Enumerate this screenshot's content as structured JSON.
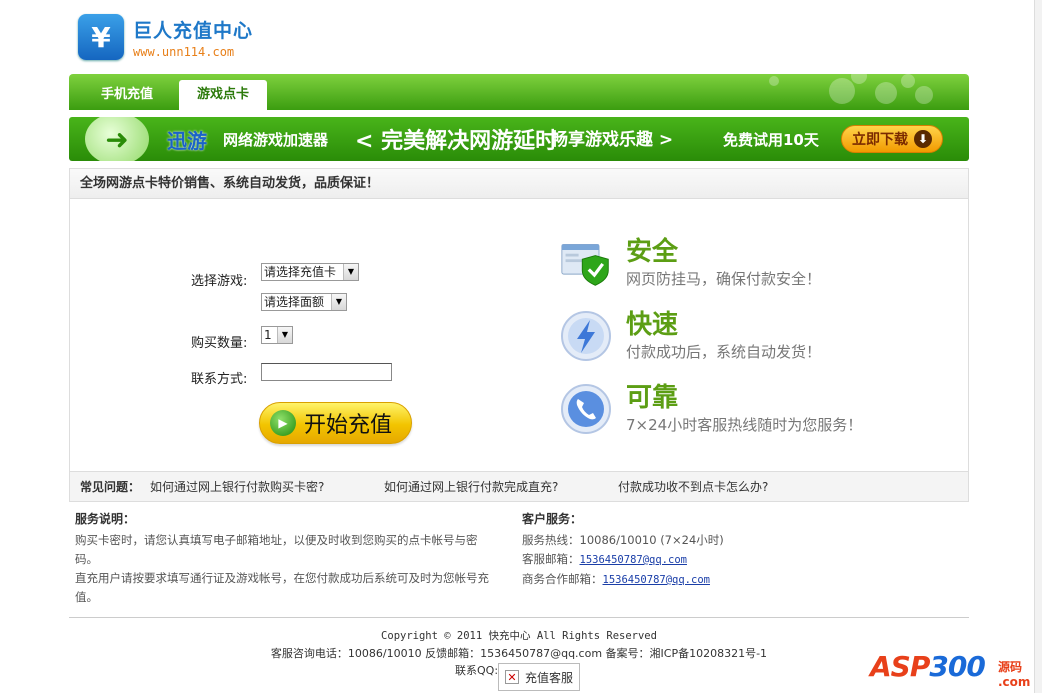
{
  "logo": {
    "title": "巨人充值中心",
    "url": "www.unn114.com",
    "icon": "yen-icon"
  },
  "nav": {
    "tabs": [
      {
        "label": "手机充值"
      },
      {
        "label": "游戏点卡"
      }
    ]
  },
  "banner": {
    "brand": "迅游",
    "product": "网络游戏加速器",
    "slogan1": "< 完美解决网游延时",
    "slogan2": "畅享游戏乐趣 >",
    "trial": "免费试用10天",
    "download_button": "立即下载"
  },
  "notice": "全场网游点卡特价销售、系统自动发货，品质保证！",
  "form": {
    "game_label": "选择游戏:",
    "card_select": "请选择充值卡",
    "amount_select": "请选择面额",
    "quantity_label": "购买数量:",
    "quantity_value": "1",
    "contact_label": "联系方式:",
    "contact_value": "",
    "start_button": "开始充值"
  },
  "features": [
    {
      "title": "安全",
      "desc": "网页防挂马，确保付款安全！",
      "icon": "shield-check-icon"
    },
    {
      "title": "快速",
      "desc": "付款成功后，系统自动发货！",
      "icon": "lightning-icon"
    },
    {
      "title": "可靠",
      "desc": "7×24小时客服热线随时为您服务！",
      "icon": "phone-icon"
    }
  ],
  "faq": {
    "title": "常见问题：",
    "items": [
      "如何通过网上银行付款购买卡密?",
      "如何通过网上银行付款完成直充?",
      "付款成功收不到点卡怎么办?"
    ]
  },
  "service": {
    "title": "服务说明：",
    "line1": "购买卡密时，请您认真填写电子邮箱地址，以便及时收到您购买的点卡帐号与密码。",
    "line2": "直充用户请按要求填写通行证及游戏帐号，在您付款成功后系统可及时为您帐号充值。"
  },
  "support": {
    "title": "客户服务：",
    "hotline": "服务热线：10086/10010 (7×24小时)",
    "email_label": "客服邮箱：",
    "email": "1536450787@qq.com",
    "biz_label": "商务合作邮箱：",
    "biz_email": "1536450787@qq.com"
  },
  "footer": {
    "copyright": "Copyright © 2011 快充中心 All Rights Reserved",
    "line2": "客服咨询电话：10086/10010   反馈邮箱：1536450787@qq.com   备案号：湘ICP备10208321号-1",
    "qq_label": "联系QQ:",
    "qq_button": "充值客服"
  },
  "watermark": {
    "brand_a": "ASP",
    "brand_b": "300",
    "sub": "源码",
    "domain": ".com"
  },
  "colors": {
    "green": "#3b9d10",
    "link": "#1a3ea8",
    "accent": "#f2c400"
  }
}
